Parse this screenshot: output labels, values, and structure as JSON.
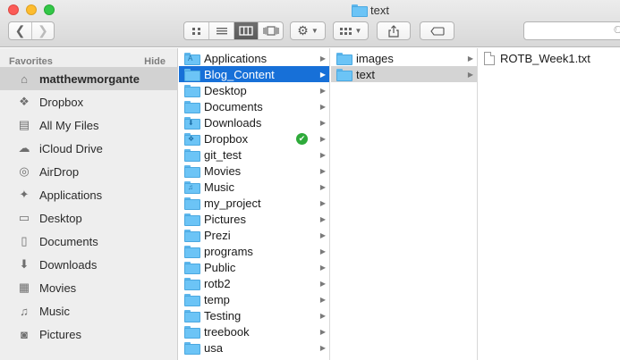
{
  "window": {
    "title": "text"
  },
  "toolbar": {
    "back_icon": "chevron-left-icon",
    "forward_icon": "chevron-right-icon",
    "views": [
      "icon-view",
      "list-view",
      "column-view",
      "cover-flow-view"
    ],
    "active_view": "column-view",
    "action_icon": "gear-icon",
    "arrange_icon": "arrange-grid-icon",
    "share_icon": "share-icon",
    "tag_icon": "tag-icon"
  },
  "sidebar": {
    "section": "Favorites",
    "hide_label": "Hide",
    "items": [
      {
        "label": "matthewmorgante",
        "icon": "home-icon",
        "glyph": "⌂"
      },
      {
        "label": "Dropbox",
        "icon": "dropbox-icon",
        "glyph": "❖"
      },
      {
        "label": "All My Files",
        "icon": "all-files-icon",
        "glyph": "▤"
      },
      {
        "label": "iCloud Drive",
        "icon": "cloud-icon",
        "glyph": "☁"
      },
      {
        "label": "AirDrop",
        "icon": "airdrop-icon",
        "glyph": "◎"
      },
      {
        "label": "Applications",
        "icon": "applications-icon",
        "glyph": "✦"
      },
      {
        "label": "Desktop",
        "icon": "desktop-icon",
        "glyph": "▭"
      },
      {
        "label": "Documents",
        "icon": "documents-icon",
        "glyph": "▯"
      },
      {
        "label": "Downloads",
        "icon": "downloads-icon",
        "glyph": "⬇"
      },
      {
        "label": "Movies",
        "icon": "movies-icon",
        "glyph": "▦"
      },
      {
        "label": "Music",
        "icon": "music-icon",
        "glyph": "♫"
      },
      {
        "label": "Pictures",
        "icon": "pictures-icon",
        "glyph": "◙"
      }
    ]
  },
  "column1": {
    "items": [
      {
        "label": "Applications",
        "badge": "A"
      },
      {
        "label": "Blog_Content",
        "badge": ""
      },
      {
        "label": "Desktop",
        "badge": ""
      },
      {
        "label": "Documents",
        "badge": ""
      },
      {
        "label": "Downloads",
        "badge": "⬇"
      },
      {
        "label": "Dropbox",
        "badge": "❖"
      },
      {
        "label": "git_test",
        "badge": ""
      },
      {
        "label": "Movies",
        "badge": ""
      },
      {
        "label": "Music",
        "badge": "♫"
      },
      {
        "label": "my_project",
        "badge": ""
      },
      {
        "label": "Pictures",
        "badge": ""
      },
      {
        "label": "Prezi",
        "badge": ""
      },
      {
        "label": "programs",
        "badge": ""
      },
      {
        "label": "Public",
        "badge": ""
      },
      {
        "label": "rotb2",
        "badge": ""
      },
      {
        "label": "temp",
        "badge": ""
      },
      {
        "label": "Testing",
        "badge": ""
      },
      {
        "label": "treebook",
        "badge": ""
      },
      {
        "label": "usa",
        "badge": ""
      }
    ],
    "selected": "Blog_Content",
    "synced_check": "✔"
  },
  "column2": {
    "items": [
      {
        "label": "images"
      },
      {
        "label": "text"
      }
    ],
    "selected": "text"
  },
  "column3": {
    "items": [
      {
        "label": "ROTB_Week1.txt"
      }
    ]
  },
  "colors": {
    "selection_active": "#1770d8",
    "selection_inactive": "#d4d4d4",
    "folder": "#6cc4f6"
  }
}
